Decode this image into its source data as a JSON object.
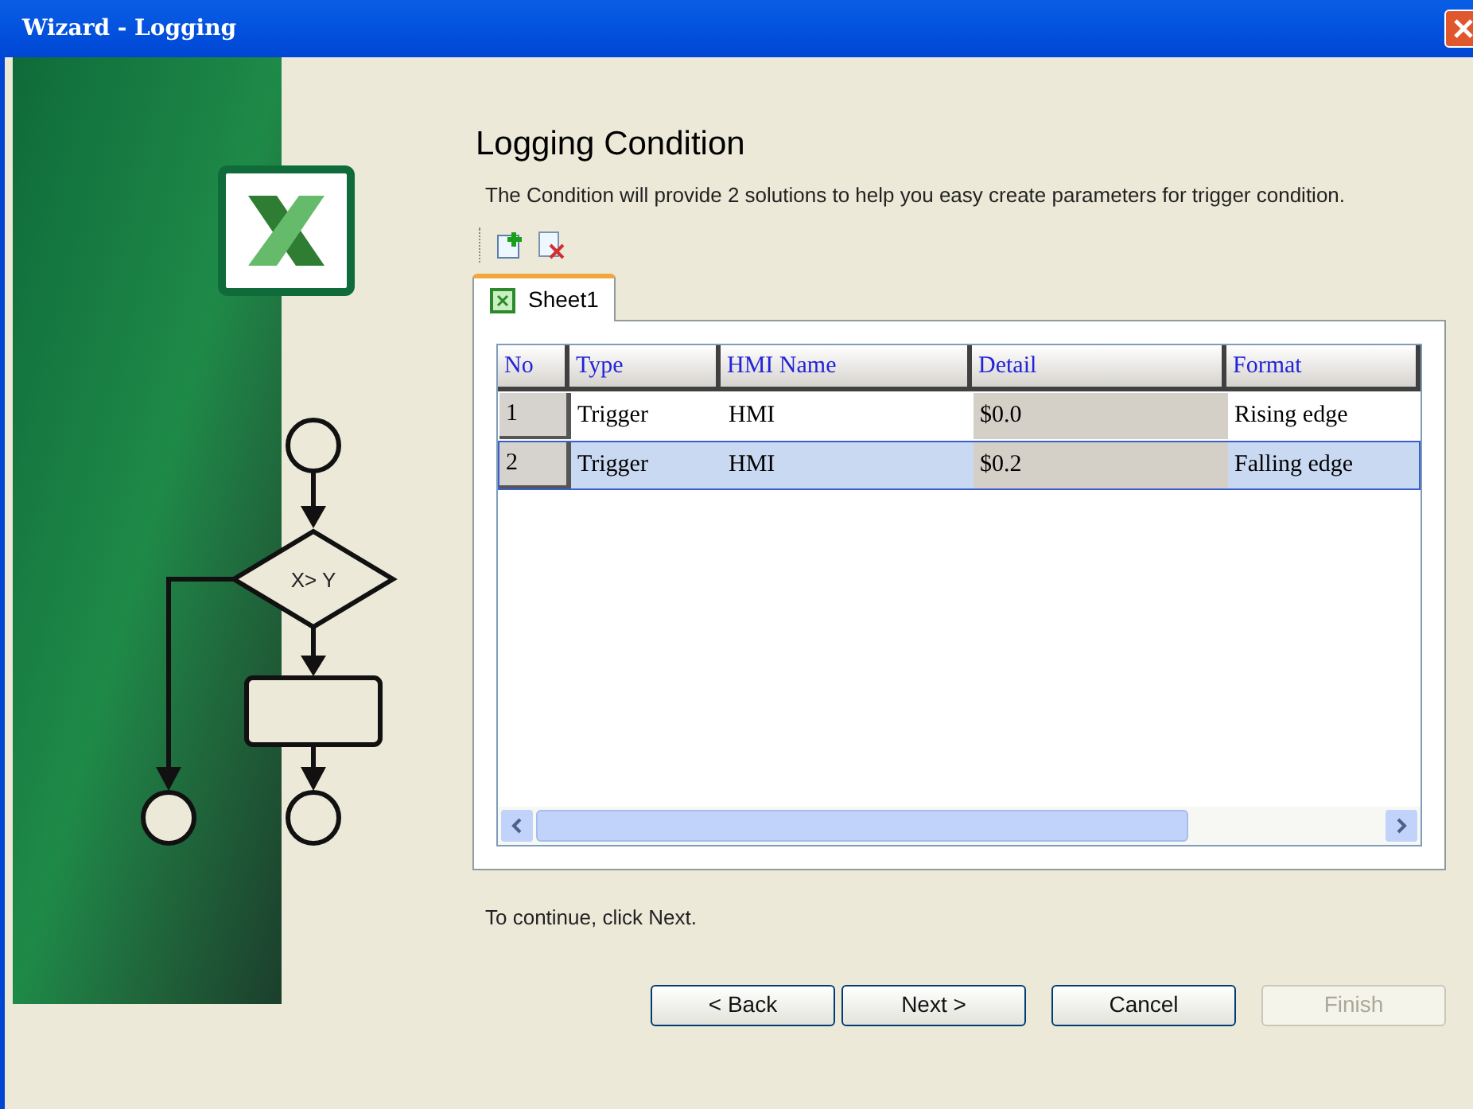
{
  "window": {
    "title": "Wizard - Logging"
  },
  "sidebar": {
    "flowchart_label": "X> Y"
  },
  "heading": "Logging Condition",
  "description": "The Condition will provide 2 solutions to  help you easy create parameters for trigger condition.",
  "tabs": [
    {
      "label": "Sheet1",
      "selected": true
    }
  ],
  "table": {
    "columns": [
      "No",
      "Type",
      "HMI Name",
      "Detail",
      "Format"
    ],
    "rows": [
      {
        "cells": [
          "1",
          "Trigger",
          "HMI",
          "$0.0",
          "Rising edge"
        ],
        "selected": false
      },
      {
        "cells": [
          "2",
          "Trigger",
          "HMI",
          "$0.2",
          "Falling edge"
        ],
        "selected": true
      }
    ]
  },
  "hint": "To continue, click Next.",
  "buttons": [
    {
      "label": "< Back",
      "disabled": false
    },
    {
      "label": "Next >",
      "disabled": false
    },
    {
      "label": "Cancel",
      "disabled": false
    },
    {
      "label": "Finish",
      "disabled": true
    }
  ]
}
